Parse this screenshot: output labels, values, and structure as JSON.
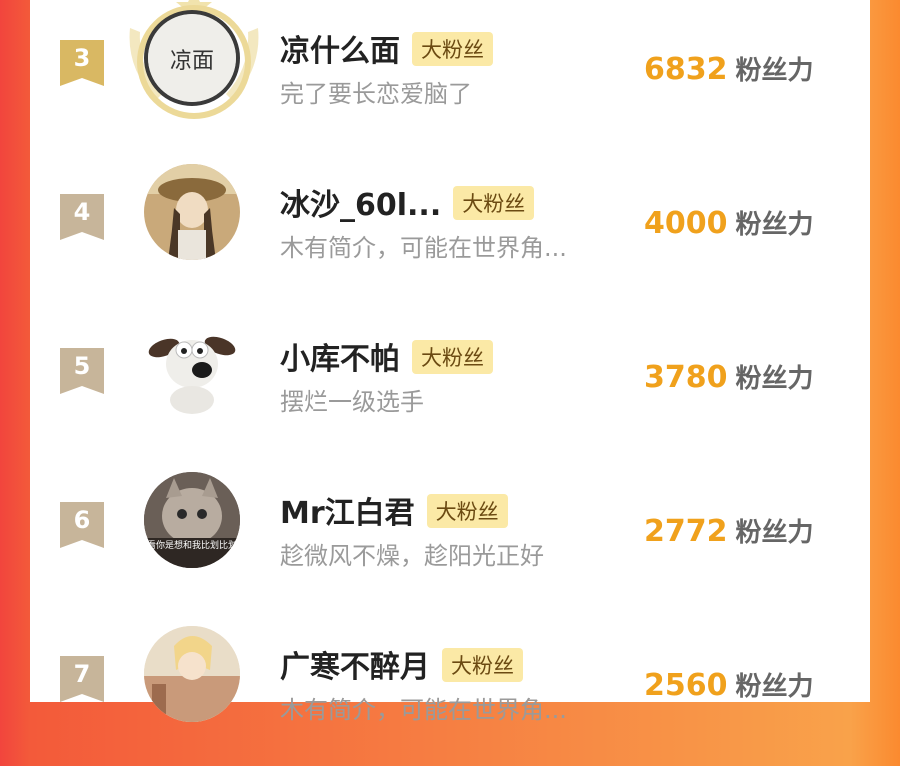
{
  "colors": {
    "score": "#f0a11c",
    "badge_bg": "#fbe9a6",
    "badge_text": "#6b4a12",
    "rank_gold": "#d9b863",
    "rank_tan": "#c7b59a"
  },
  "fans": [
    {
      "rank": "3",
      "name": "凉什么面",
      "badge": "大粉丝",
      "bio": "完了要长恋爱脑了",
      "score": "6832",
      "score_unit": "粉丝力",
      "avatar_text": "凉面"
    },
    {
      "rank": "4",
      "name": "冰沙_60l...",
      "badge": "大粉丝",
      "bio": "木有简介，可能在世界角...",
      "score": "4000",
      "score_unit": "粉丝力"
    },
    {
      "rank": "5",
      "name": "小库不帕",
      "badge": "大粉丝",
      "bio": "摆烂一级选手",
      "score": "3780",
      "score_unit": "粉丝力"
    },
    {
      "rank": "6",
      "name": "Mr江白君",
      "badge": "大粉丝",
      "bio": "趁微风不燥，趁阳光正好",
      "score": "2772",
      "score_unit": "粉丝力",
      "avatar_text": "看你是想和我比划比划"
    },
    {
      "rank": "7",
      "name": "广寒不醉月",
      "badge": "大粉丝",
      "bio": "木有简介，可能在世界角...",
      "score": "2560",
      "score_unit": "粉丝力"
    }
  ]
}
